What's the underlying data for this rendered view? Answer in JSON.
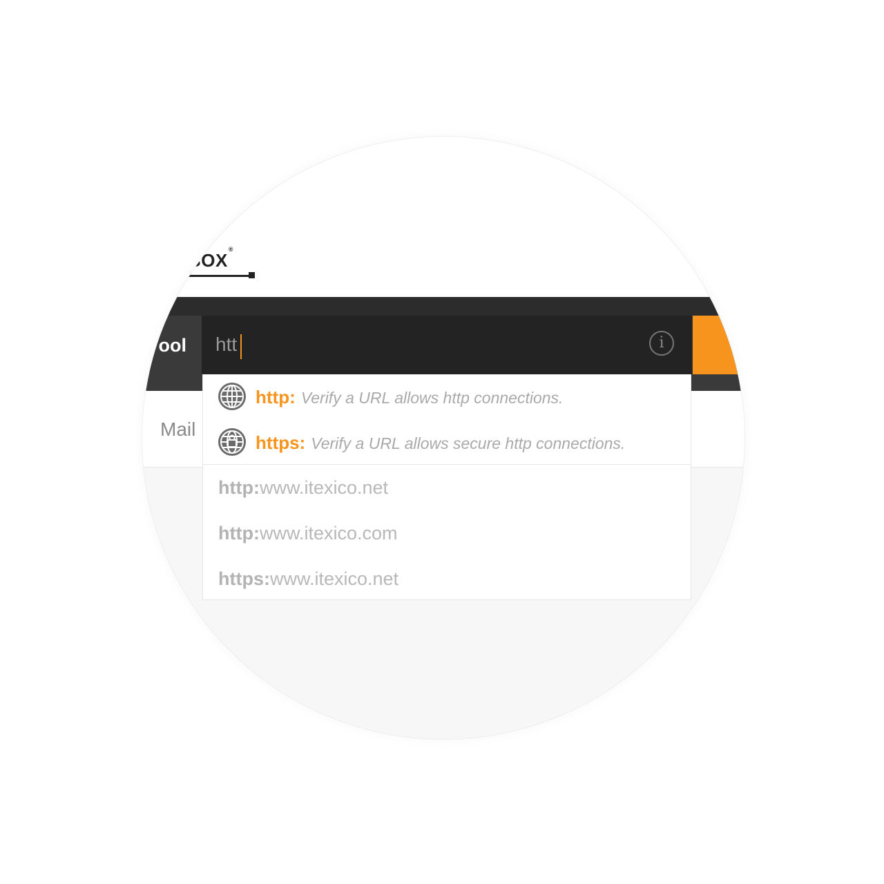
{
  "header": {
    "logo_text": "BOX",
    "logo_mark": "®"
  },
  "nav": {
    "tool_tab_label": "ool",
    "mail_label": "Mail"
  },
  "search": {
    "value": "htt",
    "info_icon": "info-icon",
    "accent_color": "#f7941d"
  },
  "suggestions": [
    {
      "protocol": "http:",
      "description": "Verify a URL allows http connections.",
      "icon": "globe-icon"
    },
    {
      "protocol": "https:",
      "description": "Verify a URL allows secure http connections.",
      "icon": "secure-globe-icon"
    }
  ],
  "recent": [
    {
      "protocol": "http:",
      "host": "www.itexico.net"
    },
    {
      "protocol": "http:",
      "host": "www.itexico.com"
    },
    {
      "protocol": "https:",
      "host": "www.itexico.net"
    }
  ]
}
